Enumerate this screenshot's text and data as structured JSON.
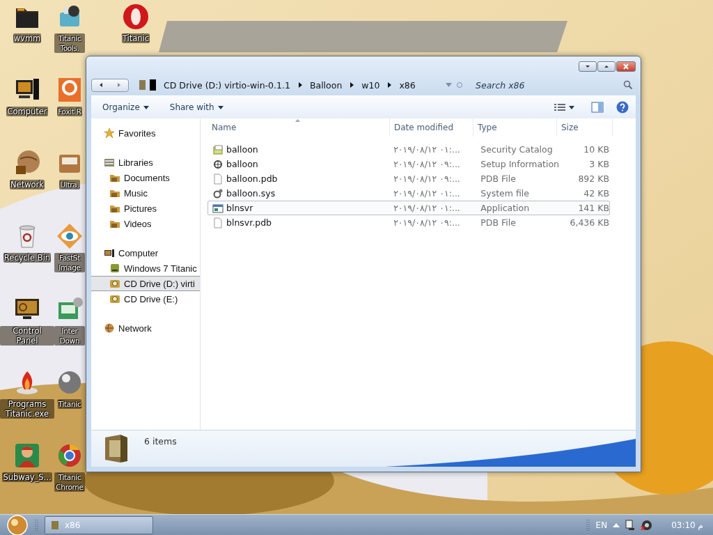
{
  "desktop": {
    "columns": [
      [
        {
          "label": "wvmm",
          "kind": "folder"
        },
        {
          "label": "Computer",
          "kind": "computer"
        },
        {
          "label": "Network",
          "kind": "globe"
        },
        {
          "label": "Recycle Bin",
          "kind": "recycle"
        },
        {
          "label": "Control Panel",
          "kind": "monitor"
        },
        {
          "label": "Programs Titanic.exe",
          "kind": "flame"
        },
        {
          "label": "Subway_S...",
          "kind": "figure"
        }
      ],
      [
        {
          "label": "Titanic Tools.",
          "kind": "tools"
        },
        {
          "label": "Foxit R",
          "kind": "pdf"
        },
        {
          "label": "Ultra.",
          "kind": "disk"
        },
        {
          "label": "FastSt Image",
          "kind": "eye"
        },
        {
          "label": "Inter Down",
          "kind": "download"
        },
        {
          "label": "Titanic",
          "kind": "sphere"
        },
        {
          "label": "Titanic Chrome",
          "kind": "ring"
        }
      ],
      [
        {
          "label": "Titanic",
          "kind": "opera"
        }
      ]
    ]
  },
  "address_bar": {
    "crumbs": [
      "CD Drive (D:) virtio-win-0.1.1",
      "Balloon",
      "w10",
      "x86"
    ]
  },
  "search": {
    "placeholder": "Search x86"
  },
  "toolbar": {
    "buttons": [
      "Organize",
      "Share with"
    ]
  },
  "navigation": [
    {
      "label": "Favorites",
      "kind": "star",
      "selected": false
    },
    {
      "label": "Libraries",
      "kind": "library",
      "selected": false,
      "children": [
        {
          "label": "Documents",
          "kind": "lib-folder",
          "selected": false
        },
        {
          "label": "Music",
          "kind": "lib-folder",
          "selected": false
        },
        {
          "label": "Pictures",
          "kind": "lib-folder",
          "selected": false
        },
        {
          "label": "Videos",
          "kind": "lib-folder",
          "selected": false
        }
      ]
    },
    {
      "label": "Computer",
      "kind": "computer",
      "selected": false,
      "children": [
        {
          "label": "Windows 7 Titanic",
          "kind": "drive",
          "selected": false
        },
        {
          "label": "CD Drive (D:) virti",
          "kind": "cd",
          "selected": true
        },
        {
          "label": "CD Drive (E:)",
          "kind": "cd",
          "selected": false
        }
      ]
    },
    {
      "label": "Network",
      "kind": "network",
      "selected": false
    }
  ],
  "columns": [
    {
      "label": "Name",
      "sorted": true
    },
    {
      "label": "Date modified",
      "sorted": false
    },
    {
      "label": "Type",
      "sorted": false
    },
    {
      "label": "Size",
      "sorted": false
    }
  ],
  "files": [
    {
      "name": "balloon",
      "date": "٢٠١٩/٠٨/١٢ ٠١:...",
      "type": "Security Catalog",
      "size": "10 KB",
      "kind": "catalog",
      "selected": false
    },
    {
      "name": "balloon",
      "date": "٢٠١٩/٠٨/١٢ ٠٩:...",
      "type": "Setup Information",
      "size": "3 KB",
      "kind": "setup",
      "selected": false
    },
    {
      "name": "balloon.pdb",
      "date": "٢٠١٩/٠٨/١٢ ٠٩:...",
      "type": "PDB File",
      "size": "892 KB",
      "kind": "blank",
      "selected": false
    },
    {
      "name": "balloon.sys",
      "date": "٢٠١٩/٠٨/١٢ ٠١:...",
      "type": "System file",
      "size": "42 KB",
      "kind": "system",
      "selected": false
    },
    {
      "name": "blnsvr",
      "date": "٢٠١٩/٠٨/١٢ ٠١:...",
      "type": "Application",
      "size": "141 KB",
      "kind": "app",
      "selected": true
    },
    {
      "name": "blnsvr.pdb",
      "date": "٢٠١٩/٠٨/١٢ ٠٩:...",
      "type": "PDB File",
      "size": "6,436 KB",
      "kind": "blank",
      "selected": false
    }
  ],
  "status": {
    "count": "6 items"
  },
  "taskbar": {
    "tasks": [
      {
        "label": "x86",
        "selected": true
      }
    ],
    "language": "EN",
    "clock": "03:10 م"
  }
}
